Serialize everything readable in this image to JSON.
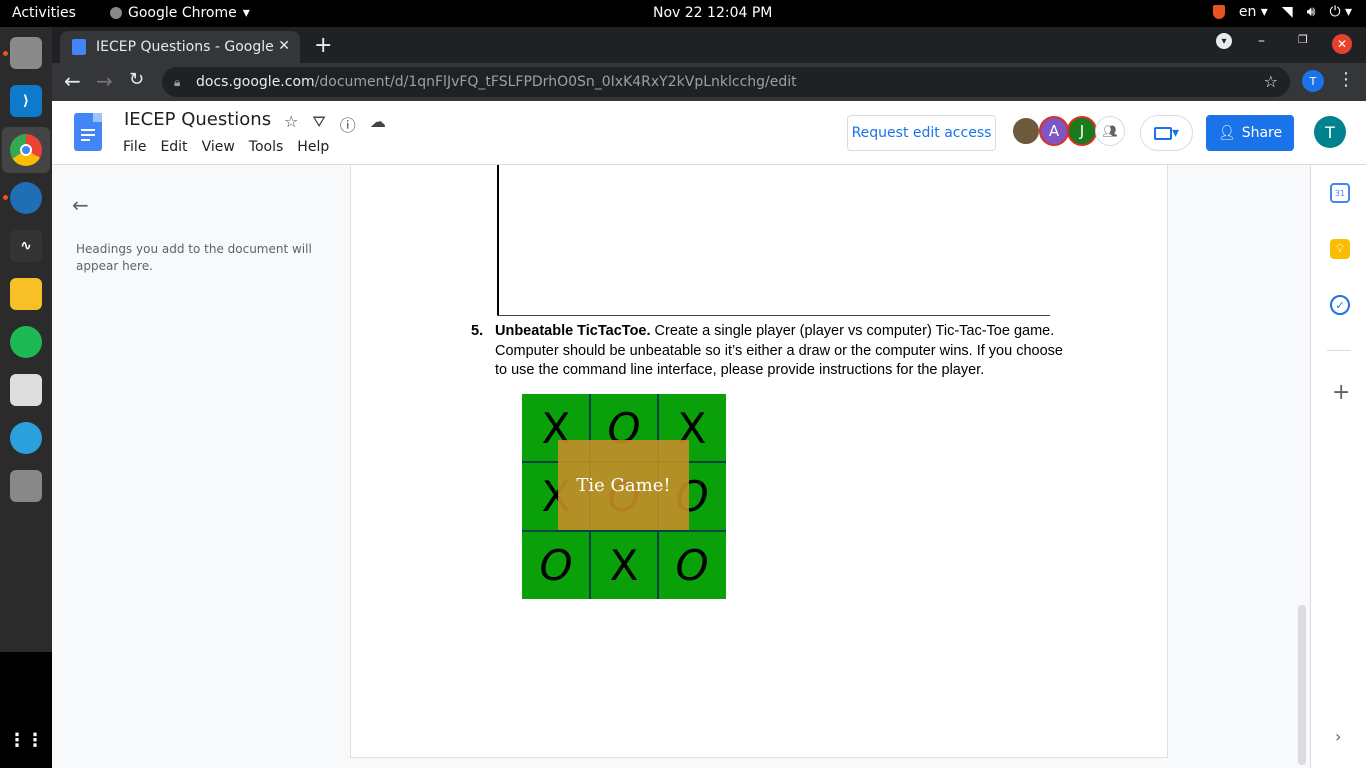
{
  "system_bar": {
    "activities": "Activities",
    "app_name": "Google Chrome",
    "clock": "Nov 22  12:04 PM",
    "lang": "en"
  },
  "browser": {
    "tab_title": "IECEP Questions - Google",
    "url_host": "docs.google.com",
    "url_path": "/document/d/1qnFlJvFQ_tFSLFPDrhO0Sn_0IxK4RxY2kVpLnklcchg/edit",
    "profile_initial": "T"
  },
  "doc": {
    "title": "IECEP Questions",
    "menu": [
      "File",
      "Edit",
      "View",
      "Tools",
      "Help"
    ],
    "request_edit_label": "Request edit access",
    "share_label": "Share",
    "avatars": [
      {
        "initial": "",
        "color": "#6d5a3a"
      },
      {
        "initial": "A",
        "color": "#7e57c2"
      },
      {
        "initial": "J",
        "color": "#1b7a1b"
      }
    ],
    "user_initial": "T"
  },
  "outline": {
    "empty_text": "Headings you add to the document will appear here."
  },
  "content": {
    "question_number": "5.",
    "question_bold": "Unbeatable TicTacToe.",
    "question_text": " Create a single player (player vs computer) Tic-Tac-Toe game. Computer should be unbeatable so it’s either a draw or the computer wins. If you choose to use the command line interface, please provide instructions for the player.",
    "board": [
      "X",
      "O",
      "X",
      "X",
      "O",
      "O",
      "O",
      "X",
      "O"
    ],
    "overlay_text": "Tie Game!"
  },
  "colors": {
    "board_green": "#0aa00a",
    "overlay": "#c48e28",
    "share_blue": "#1a73e8"
  }
}
